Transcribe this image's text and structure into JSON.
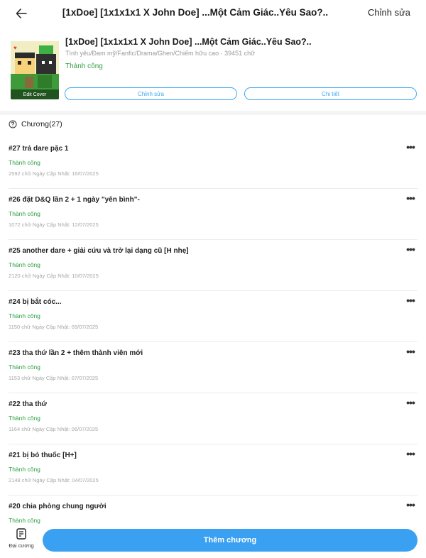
{
  "topbar": {
    "back_icon": "arrow-left-icon",
    "title": "[1xDoe] [1x1x1x1 X John Doe] ...Một Cảm Giác..Yêu Sao?..",
    "edit_label": "Chỉnh sửa"
  },
  "book": {
    "cover_label": "Edit Cover",
    "title": "[1xDoe] [1x1x1x1 X John Doe] ...Một Cảm Giác..Yêu Sao?..",
    "tags": "Tình yêu/Đam mỹ/Fanfic/Drama/Ghen/Chiếm hữu cao · 39451 chữ",
    "status": "Thành công",
    "edit_button": "Chỉnh sửa",
    "detail_button": "Chi tiết"
  },
  "chapters_header": {
    "icon": "question-circle-icon",
    "label": "Chương(27)"
  },
  "chapters": [
    {
      "title": "#27 trả dare pặc 1",
      "status": "Thành công",
      "meta": "2592 chữ Ngày Cập Nhật: 16/07/2025"
    },
    {
      "title": "#26 đặt D&Q lần 2 + 1 ngày \"yên bình\"-",
      "status": "Thành công",
      "meta": "1072 chữ Ngày Cập Nhật: 12/07/2025"
    },
    {
      "title": "#25 another dare + giải cứu và trở lại dạng cũ [H nhẹ]",
      "status": "Thành công",
      "meta": "2120 chữ Ngày Cập Nhật: 10/07/2025"
    },
    {
      "title": "#24 bị bắt cóc...",
      "status": "Thành công",
      "meta": "1150 chữ Ngày Cập Nhật: 09/07/2025"
    },
    {
      "title": "#23 tha thứ lần 2 + thêm thành viên mới",
      "status": "Thành công",
      "meta": "1153 chữ Ngày Cập Nhật: 07/07/2025"
    },
    {
      "title": "#22 tha thứ",
      "status": "Thành công",
      "meta": "1164 chữ Ngày Cập Nhật: 06/07/2025"
    },
    {
      "title": "#21 bị bỏ thuốc [H+]",
      "status": "Thành công",
      "meta": "2148 chữ Ngày Cập Nhật: 04/07/2025"
    },
    {
      "title": "#20 chia phòng chung người",
      "status": "Thành công",
      "meta": ""
    }
  ],
  "chapter_more_icon": "more-horizontal-icon",
  "bottom": {
    "outline_icon": "document-icon",
    "outline_label": "Đại cương",
    "add_button": "Thêm chương"
  },
  "colors": {
    "accent": "#3aa0f1",
    "success": "#2ea043",
    "muted": "#a8a8a8"
  }
}
